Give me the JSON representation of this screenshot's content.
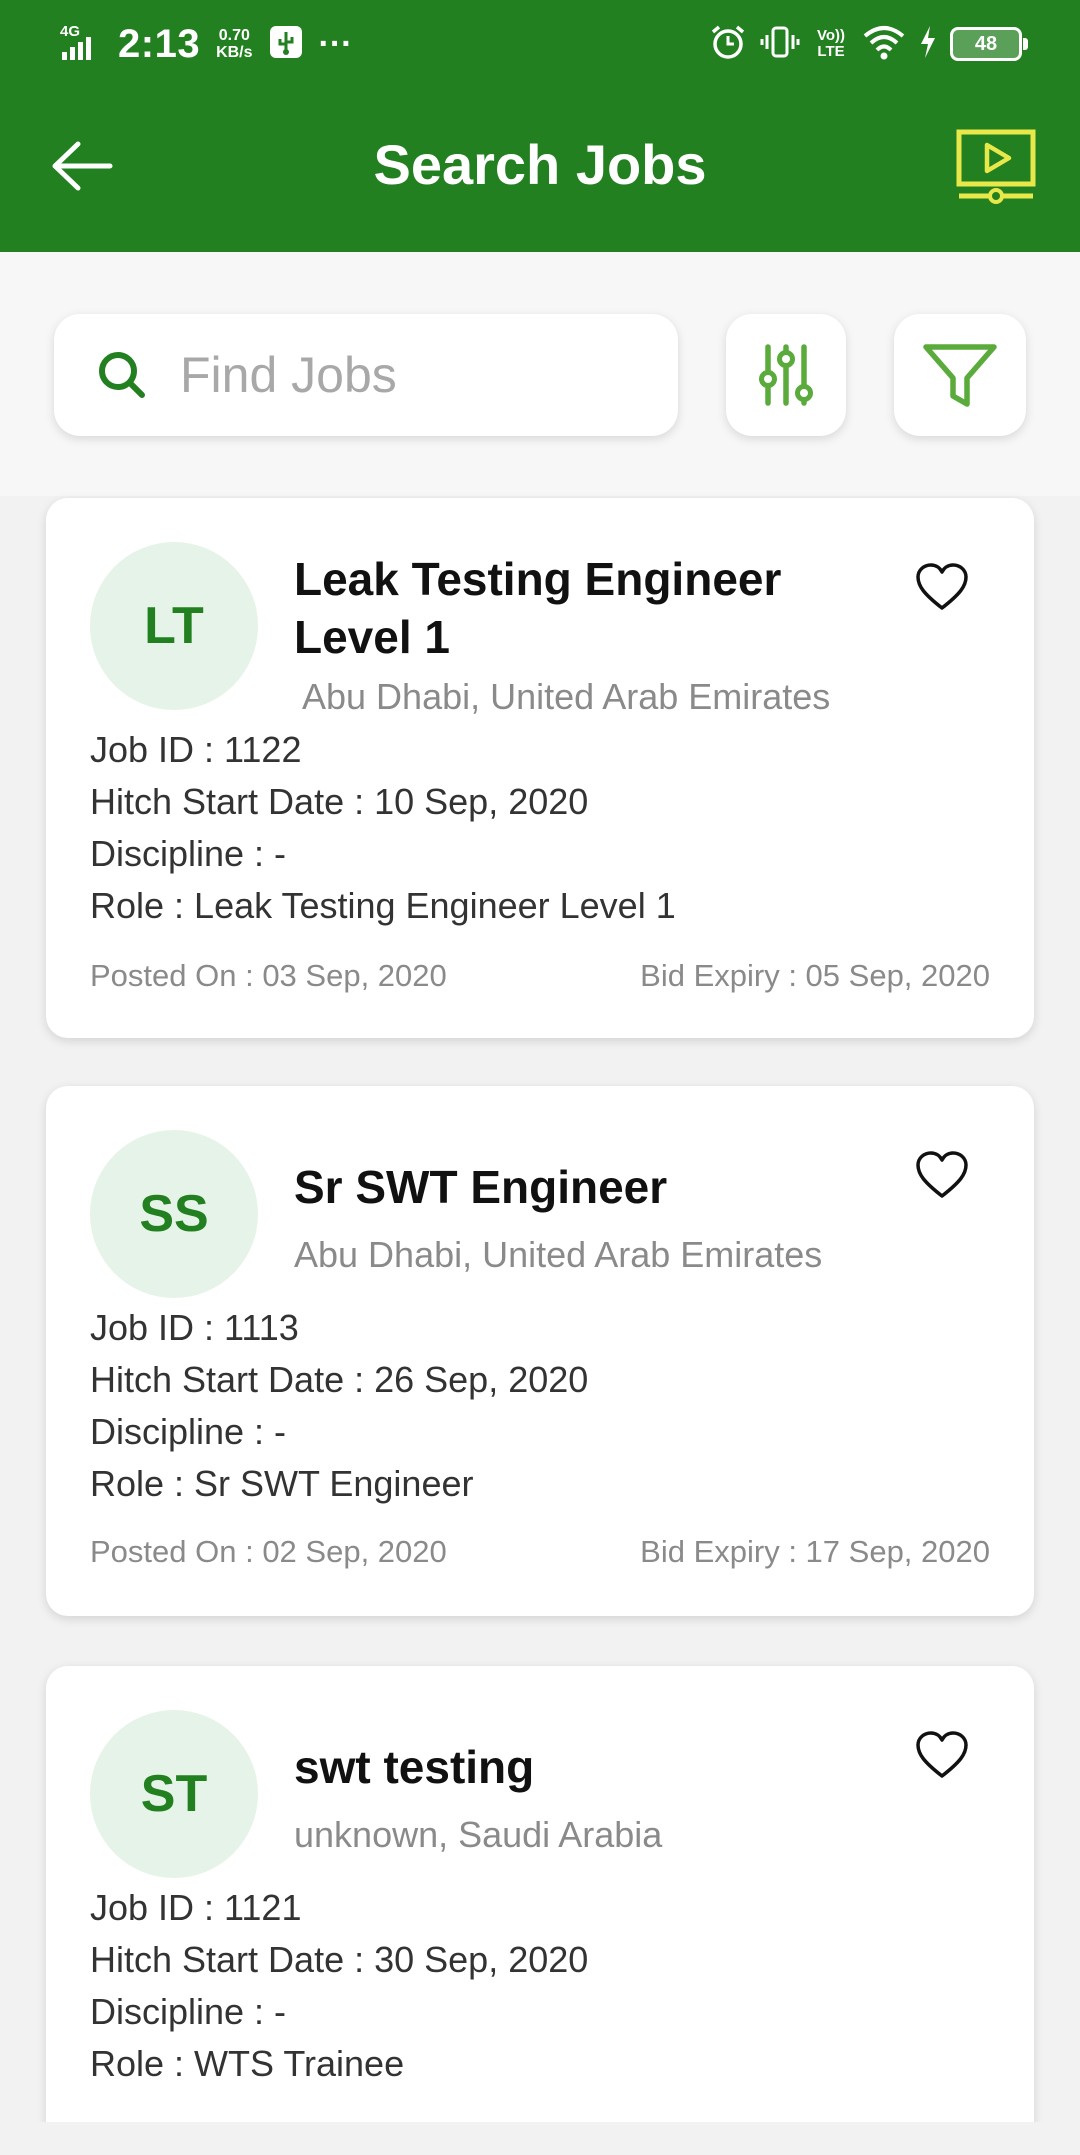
{
  "status_bar": {
    "network": "4G",
    "time": "2:13",
    "speed_value": "0.70",
    "speed_unit": "KB/s",
    "more": "···",
    "volte": "Vo)) LTE",
    "battery": "48"
  },
  "header": {
    "title": "Search Jobs",
    "back_icon": "arrow-left-icon",
    "video_icon": "video-tutorial-icon"
  },
  "search": {
    "placeholder": "Find Jobs",
    "value": ""
  },
  "colors": {
    "brand": "#238020",
    "accent_yellow": "#e8e84a",
    "avatar_bg": "#e6f3e8"
  },
  "jobs": [
    {
      "initials": "LT",
      "title": "Leak Testing Engineer Level 1",
      "location": "Abu Dhabi, United Arab Emirates",
      "job_id": "Job ID : 1122",
      "hitch": "Hitch Start Date : 10 Sep, 2020",
      "discipline": "Discipline :  -",
      "role": "Role : Leak Testing Engineer Level 1",
      "posted": "Posted On : 03 Sep, 2020",
      "expiry": "Bid Expiry : 05 Sep, 2020"
    },
    {
      "initials": "SS",
      "title": "Sr SWT Engineer",
      "location": "Abu Dhabi, United Arab Emirates",
      "job_id": "Job ID : 1113",
      "hitch": "Hitch Start Date : 26 Sep, 2020",
      "discipline": "Discipline :  -",
      "role": "Role : Sr SWT Engineer",
      "posted": "Posted On : 02 Sep, 2020",
      "expiry": "Bid Expiry : 17 Sep, 2020"
    },
    {
      "initials": "ST",
      "title": "swt testing",
      "location": "unknown, Saudi Arabia",
      "job_id": "Job ID : 1121",
      "hitch": "Hitch Start Date : 30 Sep, 2020",
      "discipline": "Discipline :  -",
      "role": "Role : WTS Trainee"
    }
  ]
}
